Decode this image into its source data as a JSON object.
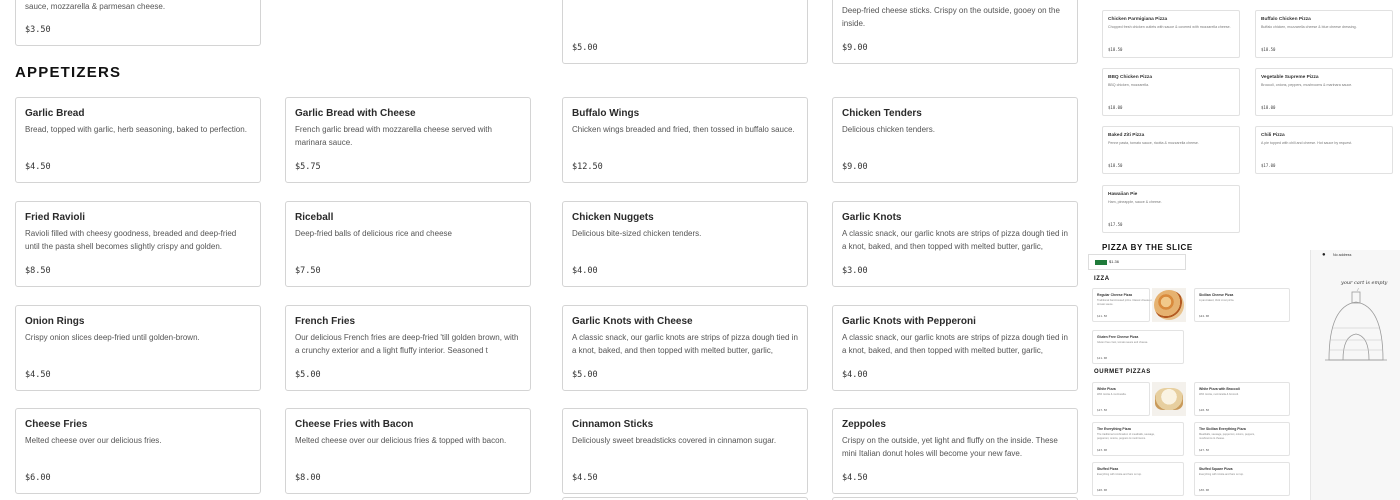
{
  "top_partial": {
    "desc": "sauce, mozzarella & parmesan cheese.",
    "price": "$3.50",
    "col3_price": "$5.00",
    "col4_desc": "Deep-fried cheese sticks. Crispy on the outside, gooey on the inside.",
    "col4_price": "$9.00"
  },
  "section": {
    "title": "APPETIZERS"
  },
  "items": [
    {
      "title": "Garlic Bread",
      "desc": "Bread, topped with garlic, herb seasoning, baked to perfection.",
      "price": "$4.50"
    },
    {
      "title": "Garlic Bread with Cheese",
      "desc": "French garlic bread with mozzarella cheese served with marinara sauce.",
      "price": "$5.75"
    },
    {
      "title": "Buffalo Wings",
      "desc": "Chicken wings breaded and fried, then tossed in buffalo sauce.",
      "price": "$12.50"
    },
    {
      "title": "Chicken Tenders",
      "desc": "Delicious chicken tenders.",
      "price": "$9.00"
    },
    {
      "title": "Fried Ravioli",
      "desc": "Ravioli filled with cheesy goodness, breaded and deep-fried until the pasta shell becomes slightly crispy and golden.",
      "price": "$8.50"
    },
    {
      "title": "Riceball",
      "desc": "Deep-fried balls of delicious rice and cheese",
      "price": "$7.50"
    },
    {
      "title": "Chicken Nuggets",
      "desc": "Delicious bite-sized chicken tenders.",
      "price": "$4.00"
    },
    {
      "title": "Garlic Knots",
      "desc": "A classic snack, our garlic knots are strips of pizza dough tied in a knot, baked, and then topped with melted butter, garlic,",
      "price": "$3.00"
    },
    {
      "title": "Onion Rings",
      "desc": "Crispy onion slices deep-fried until golden-brown.",
      "price": "$4.50"
    },
    {
      "title": "French Fries",
      "desc": "Our delicious French fries are deep-fried 'till golden brown, with a crunchy exterior and a light fluffy interior. Seasoned t",
      "price": "$5.00"
    },
    {
      "title": "Garlic Knots with Cheese",
      "desc": "A classic snack, our garlic knots are strips of pizza dough tied in a knot, baked, and then topped with melted butter, garlic,",
      "price": "$5.00"
    },
    {
      "title": "Garlic Knots with Pepperoni",
      "desc": "A classic snack, our garlic knots are strips of pizza dough tied in a knot, baked, and then topped with melted butter, garlic,",
      "price": "$4.00"
    },
    {
      "title": "Cheese Fries",
      "desc": "Melted cheese over our delicious fries.",
      "price": "$6.00"
    },
    {
      "title": "Cheese Fries with Bacon",
      "desc": "Melted cheese over our delicious fries & topped with bacon.",
      "price": "$8.00"
    },
    {
      "title": "Cinnamon Sticks",
      "desc": "Deliciously sweet breadsticks covered in cinnamon sugar.",
      "price": "$4.50"
    },
    {
      "title": "Zeppoles",
      "desc": "Crispy on the outside, yet light and fluffy on the inside. These mini Italian donut holes will become your new fave.",
      "price": "$4.50"
    }
  ],
  "mini_catalog": {
    "items": [
      {
        "title": "Chicken Parmigiana Pizza",
        "desc": "Chopped fresh chicken cutlets with sauce & covered with mozzarella cheese.",
        "price": "$18.50"
      },
      {
        "title": "Buffalo Chicken Pizza",
        "desc": "Buffalo chicken, mozzarella cheese & blue cheese dressing.",
        "price": "$18.50"
      },
      {
        "title": "BBQ Chicken Pizza",
        "desc": "BBQ chicken, mozzarella.",
        "price": "$18.00"
      },
      {
        "title": "Vegetable Supreme Pizza",
        "desc": "Broccoli, onions, peppers, mushrooms & marinara sauce.",
        "price": "$18.00"
      },
      {
        "title": "Baked Ziti Pizza",
        "desc": "Penne pasta, tomato sauce, ricotta & mozzarella cheese.",
        "price": "$18.50"
      },
      {
        "title": "Chili Pizza",
        "desc": "A pie topped with chili and cheese. Hot sauce by request.",
        "price": "$17.00"
      },
      {
        "title": "Hawaiian Pie",
        "desc": "Ham, pineapple, sauce & cheese.",
        "price": "$17.50"
      }
    ],
    "section_title": "PIZZA BY THE SLICE"
  },
  "screenshot": {
    "topbar_price": "$1.36",
    "address_label": "No address",
    "cart_text": "your cart is empty",
    "heading_pizza": "IZZA",
    "heading_gourmet": "OURMET PIZZAS",
    "tiles": [
      {
        "title": "Regular Cheese Pizza",
        "desc": "Traditional hand-tossed pizza. Classic cheese on tomato sauce.",
        "price": "$11.50"
      },
      {
        "title": "Sicilian Cheese Pizza",
        "desc": "A pan-baked, thick crust pizza.",
        "price": "$24.00"
      },
      {
        "title": "Gluten Free Cheese Pizza",
        "desc": "Gluten free crust, tomato sauce and cheese.",
        "price": "$11.00"
      },
      {
        "title": "White Pizza",
        "desc": "With ricotta & mozzarella.",
        "price": "$17.50"
      },
      {
        "title": "White Pizza with Broccoli",
        "desc": "With ricotta, mozzarella & broccoli.",
        "price": "$18.50"
      },
      {
        "title": "The Everything Pizza",
        "desc": "The traditional combination of meatballs, sausage, pepperoni, onions, peppers & mushrooms.",
        "price": "$23.00"
      },
      {
        "title": "The Sicilian Everything Pizza",
        "desc": "Meatballs, sausage, pepperoni, onions, peppers, mushrooms & cheese.",
        "price": "$27.50"
      },
      {
        "title": "Stuffed Pizza",
        "desc": "Everything with ricotta and ham on top.",
        "price": "$20.00"
      },
      {
        "title": "Stuffed Square Pizza",
        "desc": "Everything with ricotta and ham on top.",
        "price": "$30.00"
      }
    ]
  },
  "colors": {
    "border": "#d4d4d4",
    "text": "#222222",
    "muted": "#555555",
    "accent_green": "#1f7a3a"
  }
}
